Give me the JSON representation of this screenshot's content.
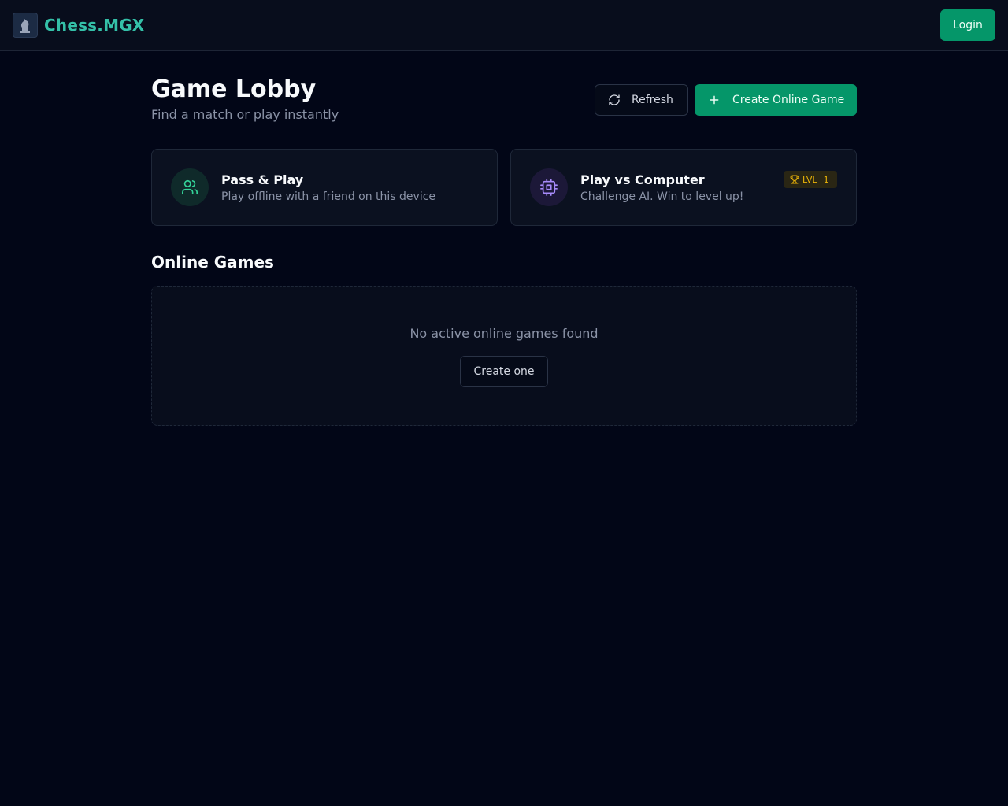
{
  "header": {
    "logo_icon": "knight-chess-icon",
    "brand": "Chess.MGX",
    "login_label": "Login"
  },
  "lobby": {
    "title": "Game Lobby",
    "subtitle": "Find a match or play instantly",
    "refresh_label": "Refresh",
    "refresh_icon": "refresh-icon",
    "create_label": "Create Online Game",
    "create_icon": "plus-icon"
  },
  "modes": [
    {
      "title": "Pass & Play",
      "description": "Play offline with a friend on this device",
      "icon": "users-icon",
      "accent": "#34d399"
    },
    {
      "title": "Play vs Computer",
      "description": "Challenge AI. Win to level up!",
      "icon": "cpu-icon",
      "accent": "#a78bfa",
      "badge": {
        "icon": "trophy-icon",
        "text": "LVL",
        "level": "1",
        "color": "#eab308"
      }
    }
  ],
  "online": {
    "title": "Online Games",
    "empty_text": "No active online games found",
    "create_one_label": "Create one"
  },
  "colors": {
    "background": "#020617",
    "accent_green": "#059669",
    "brand_teal": "#34c0a8"
  }
}
